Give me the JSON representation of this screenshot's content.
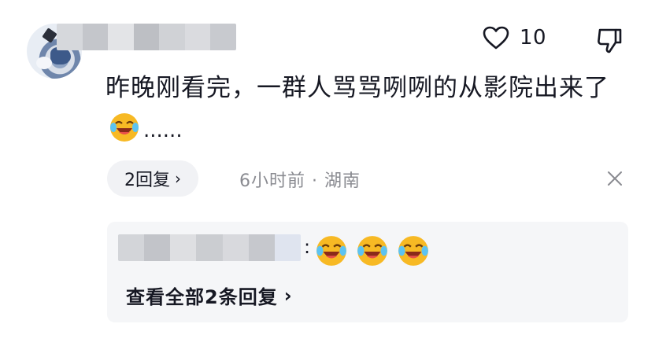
{
  "comment": {
    "like_count": "10",
    "text_part1": "昨晚刚看完，一群人骂骂咧咧的从影院出来了",
    "emoji_1": "laughing-crying-emoji",
    "text_part2": "......",
    "reply_count_label": "2回复",
    "meta": "6小时前 · 湖南"
  },
  "reply": {
    "colon": ":",
    "emojis": [
      "laughing-crying-emoji",
      "laughing-crying-emoji",
      "laughing-crying-emoji"
    ],
    "view_all_label": "查看全部2条回复"
  },
  "colors": {
    "text": "#161823",
    "meta": "#8a8b91",
    "chip_bg": "#f1f2f5",
    "reply_bg": "#f5f6f8",
    "emoji_yellow": "#f7b924"
  }
}
